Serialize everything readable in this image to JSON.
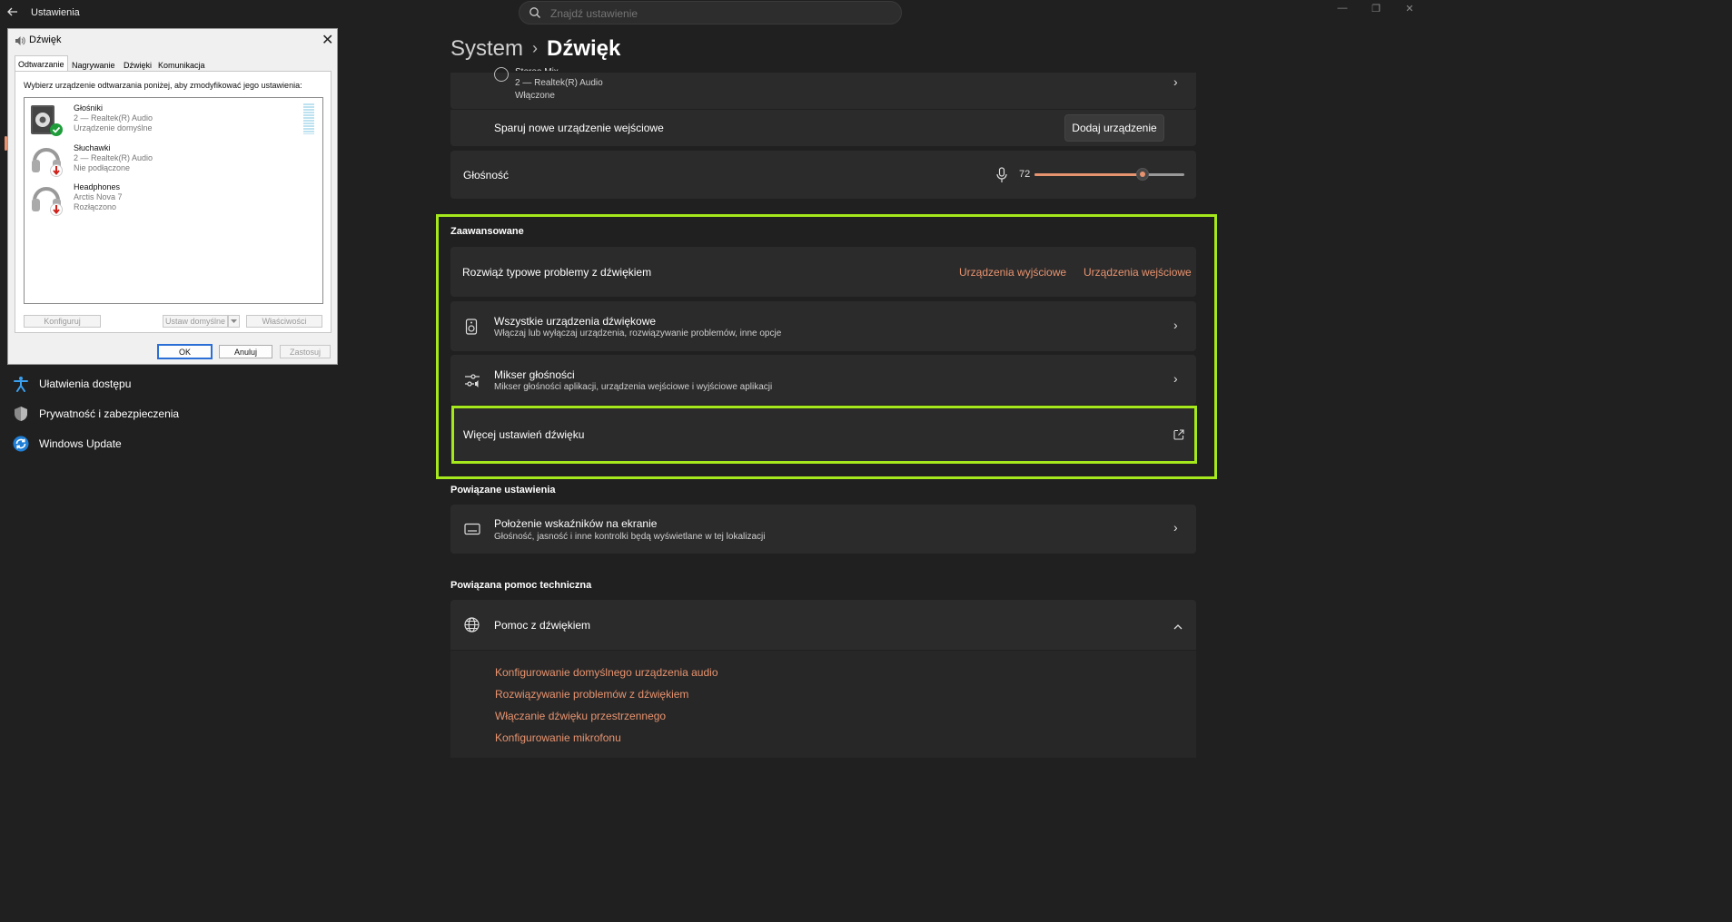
{
  "window": {
    "title": "Ustawienia"
  },
  "search": {
    "placeholder": "Znajdź ustawienie"
  },
  "nav": [
    {
      "label": "Ułatwienia dostępu",
      "icon": "accessibility-icon"
    },
    {
      "label": "Prywatność i zabezpieczenia",
      "icon": "shield-icon"
    },
    {
      "label": "Windows Update",
      "icon": "windows-update-icon"
    }
  ],
  "breadcrumb": {
    "parent": "System",
    "separator": "›",
    "current": "Dźwięk"
  },
  "input_device": {
    "name": "Stereo Mix",
    "sub": "2 — Realtek(R) Audio",
    "status": "Włączone"
  },
  "pair": {
    "label": "Sparuj nowe urządzenie wejściowe",
    "button": "Dodaj urządzenie"
  },
  "volume": {
    "label": "Głośność",
    "value": "72",
    "level": 0.72
  },
  "advanced": {
    "heading": "Zaawansowane",
    "troubleshoot": {
      "label": "Rozwiąż typowe problemy z dźwiękiem",
      "link_output": "Urządzenia wyjściowe",
      "link_input": "Urządzenia wejściowe"
    },
    "all_devices": {
      "title": "Wszystkie urządzenia dźwiękowe",
      "sub": "Włączaj lub wyłączaj urządzenia, rozwiązywanie problemów, inne opcje"
    },
    "mixer": {
      "title": "Mikser głośności",
      "sub": "Mikser głośności aplikacji, urządzenia wejściowe i wyjściowe aplikacji"
    },
    "more": {
      "title": "Więcej ustawień dźwięku"
    }
  },
  "related": {
    "heading": "Powiązane ustawienia",
    "indicator": {
      "title": "Położenie wskaźników na ekranie",
      "sub": "Głośność, jasność i inne kontrolki będą wyświetlane w tej lokalizacji"
    }
  },
  "help": {
    "heading": "Powiązana pomoc techniczna",
    "title": "Pomoc z dźwiękiem",
    "links": [
      "Konfigurowanie domyślnego urządzenia audio",
      "Rozwiązywanie problemów z dźwiękiem",
      "Włączanie dźwięku przestrzennego",
      "Konfigurowanie mikrofonu"
    ]
  },
  "dialog": {
    "title": "Dźwięk",
    "tabs": [
      "Odtwarzanie",
      "Nagrywanie",
      "Dźwięki",
      "Komunikacja"
    ],
    "instruction": "Wybierz urządzenie odtwarzania poniżej, aby zmodyfikować jego ustawienia:",
    "devices": [
      {
        "name": "Głośniki",
        "driver": "2 — Realtek(R) Audio",
        "status": "Urządzenie domyślne"
      },
      {
        "name": "Słuchawki",
        "driver": "2 — Realtek(R) Audio",
        "status": "Nie podłączone"
      },
      {
        "name": "Headphones",
        "driver": "Arctis Nova 7",
        "status": "Rozłączono"
      }
    ],
    "buttons": {
      "configure": "Konfiguruj",
      "set_default": "Ustaw domyślne",
      "properties": "Właściwości",
      "ok": "OK",
      "cancel": "Anuluj",
      "apply": "Zastosuj"
    }
  },
  "colors": {
    "accent": "#e8936f",
    "highlight": "#a5e81c",
    "background": "#202020",
    "card": "#2b2b2b"
  }
}
